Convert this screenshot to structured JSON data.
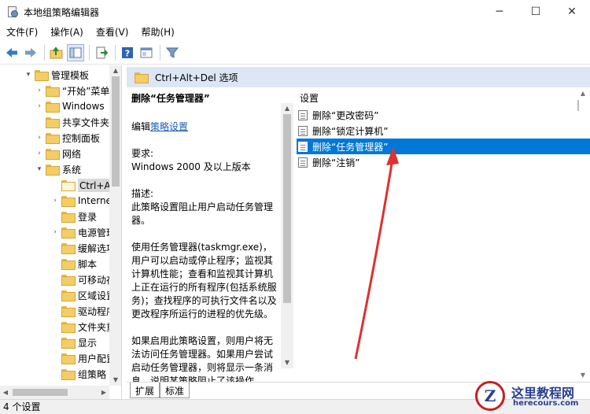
{
  "window": {
    "title": "本地组策略编辑器",
    "minimize_glyph": "─",
    "maximize_glyph": "☐",
    "close_glyph": "✕"
  },
  "menu": [
    "文件(F)",
    "操作(A)",
    "查看(V)",
    "帮助(H)"
  ],
  "toolbar_icons": [
    "back-arrow-icon",
    "forward-arrow-icon",
    "up-folder-icon",
    "show-hide-tree-icon",
    "export-list-icon",
    "help-icon",
    "properties-icon",
    "filter-icon"
  ],
  "tree": {
    "items": [
      {
        "label": "管理模板",
        "expand": "▾"
      },
      {
        "label": "“开始”菜单",
        "expand": "›"
      },
      {
        "label": "Windows",
        "expand": "›"
      },
      {
        "label": "共享文件夹",
        "expand": ""
      },
      {
        "label": "控制面板",
        "expand": "›"
      },
      {
        "label": "网络",
        "expand": "›"
      },
      {
        "label": "系统",
        "expand": "▾"
      },
      {
        "label": "Ctrl+Alt+Del 选项",
        "expand": ""
      },
      {
        "label": "Internet",
        "expand": "›"
      },
      {
        "label": "登录",
        "expand": ""
      },
      {
        "label": "电源管理",
        "expand": "›"
      },
      {
        "label": "缓解选项",
        "expand": ""
      },
      {
        "label": "脚本",
        "expand": ""
      },
      {
        "label": "可移动存储",
        "expand": ""
      },
      {
        "label": "区域设置",
        "expand": ""
      },
      {
        "label": "驱动程序",
        "expand": ""
      },
      {
        "label": "文件夹重定向",
        "expand": ""
      },
      {
        "label": "显示",
        "expand": ""
      },
      {
        "label": "用户配置文件",
        "expand": ""
      },
      {
        "label": "组策略",
        "expand": ""
      }
    ]
  },
  "header": {
    "title": "Ctrl+Alt+Del 选项"
  },
  "description": {
    "title": "删除“任务管理器”",
    "edit_prefix": "编辑",
    "edit_link": "策略设置",
    "requirements_label": "要求:",
    "requirements_value": "Windows 2000 及以上版本",
    "description_label": "描述:",
    "description_text": "此策略设置阻止用户启动任务管理器。",
    "usage_text": "使用任务管理器(taskmgr.exe)，用户可以启动或停止程序；监视其计算机性能；查看和监视其计算机上正在运行的所有程序(包括系统服务)；查找程序的可执行文件名以及更改程序所运行的进程的优先级。",
    "enabled_text": "如果启用此策略设置，则用户将无法访问任务管理器。如果用户尝试启动任务管理器，则将显示一条消息，说明某策略阻止了该操作。"
  },
  "settings": {
    "column_header": "设置",
    "items": [
      {
        "label": "删除“更改密码”",
        "selected": false
      },
      {
        "label": "删除“锁定计算机”",
        "selected": false
      },
      {
        "label": "删除“任务管理器”",
        "selected": true
      },
      {
        "label": "删除“注销”",
        "selected": false
      }
    ]
  },
  "tabs": [
    "扩展",
    "标准"
  ],
  "status": {
    "text": "4 个设置"
  },
  "watermark": {
    "logo": "Z",
    "name": "这里教程网",
    "url": "herecours.com"
  },
  "colors": {
    "selection": "#0078d7",
    "header_bg": "#dce6f4",
    "arrow": "#e03030",
    "link": "#1a5fb4"
  }
}
